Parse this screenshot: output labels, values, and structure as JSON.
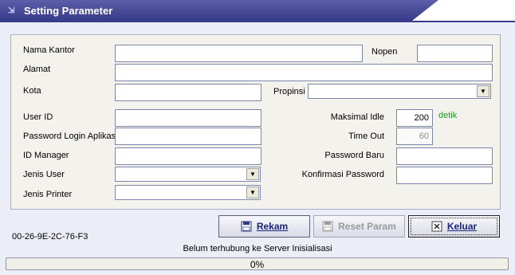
{
  "window": {
    "title": "Setting Parameter"
  },
  "labels": {
    "nama_kantor": "Nama Kantor",
    "nopen": "Nopen",
    "alamat": "Alamat",
    "kota": "Kota",
    "propinsi": "Propinsi",
    "user_id": "User ID",
    "password_login": "Password Login Aplikasi",
    "id_manager": "ID Manager",
    "jenis_user": "Jenis User",
    "jenis_printer": "Jenis Printer",
    "maksimal_idle": "Maksimal Idle",
    "time_out": "Time Out",
    "password_baru": "Password Baru",
    "konfirmasi_password": "Konfirmasi Password",
    "idle_unit": "detik"
  },
  "values": {
    "nama_kantor": "",
    "nopen": "",
    "alamat": "",
    "kota": "",
    "propinsi": "",
    "user_id": "",
    "password_login": "",
    "id_manager": "",
    "jenis_user": "",
    "jenis_printer": "",
    "maksimal_idle": "200",
    "time_out": "60",
    "password_baru": "",
    "konfirmasi_password": ""
  },
  "buttons": {
    "rekam": "Rekam",
    "reset_param": "Reset Param",
    "keluar": "Keluar"
  },
  "mac_address": "00-26-9E-2C-76-F3",
  "status_text": "Belum terhubung ke Server Inisialisasi",
  "progress": {
    "value": 0,
    "label": "0%"
  },
  "colors": {
    "title_bar": "#3a3d8e",
    "accent_green": "#1a9a1a",
    "button_text": "#1a237e"
  },
  "icons": {
    "title": "collapse-icon",
    "rekam": "save-icon",
    "reset_param": "save-icon",
    "keluar": "close-icon"
  }
}
